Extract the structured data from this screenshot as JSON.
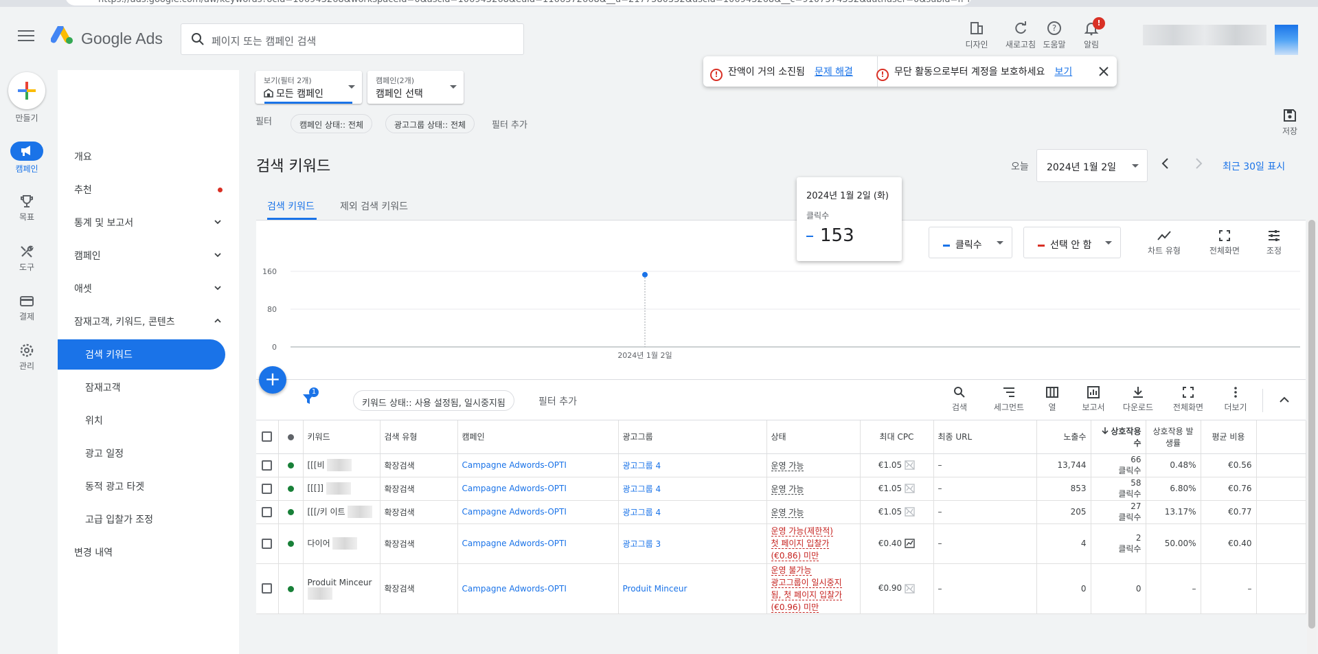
{
  "browser": {
    "url": "https://ads.google.com/aw/keywords?ocid=106943268&workspaceId=0&ascid=106943268&euid=1166372668&__u=2177580332&uscid=106943268&__c=9107574332&authuser=0&subid=fr-fr-awhp-g-aw-c-ho..."
  },
  "header": {
    "logo_text": "Google Ads",
    "search_placeholder": "페이지 또는 캠페인 검색",
    "tools": [
      {
        "label": "디자인",
        "icon": "design-icon"
      },
      {
        "label": "새로고침",
        "icon": "refresh-icon"
      },
      {
        "label": "도움말",
        "icon": "help-icon"
      },
      {
        "label": "알림",
        "icon": "bell-icon"
      }
    ],
    "notification_badge": "!"
  },
  "rail": {
    "create_label": "만들기",
    "items": [
      {
        "label": "캠페인",
        "icon": "megaphone-icon",
        "active": true
      },
      {
        "label": "목표",
        "icon": "trophy-icon"
      },
      {
        "label": "도구",
        "icon": "wrench-icon"
      },
      {
        "label": "결제",
        "icon": "credit-card-icon"
      },
      {
        "label": "관리",
        "icon": "gear-icon"
      }
    ]
  },
  "nav": {
    "items": [
      {
        "label": "개요"
      },
      {
        "label": "추천"
      },
      {
        "label": "통계 및 보고서"
      },
      {
        "label": "캠페인"
      },
      {
        "label": "애셋"
      },
      {
        "label": "잠재고객, 키워드, 콘텐츠"
      },
      {
        "label": "검색 키워드"
      },
      {
        "label": "잠재고객"
      },
      {
        "label": "위치"
      },
      {
        "label": "광고 일정"
      },
      {
        "label": "동적 광고 타겟"
      },
      {
        "label": "고급 입찰가 조정"
      },
      {
        "label": "변경 내역"
      }
    ]
  },
  "view_selector": {
    "small": "보기(필터 2개)",
    "value": "모든 캠페인"
  },
  "campaign_selector": {
    "small": "캠페인(2개)",
    "value": "캠페인 선택"
  },
  "alerts": [
    {
      "text": "잔액이 거의 소진됨",
      "link": "문제 해결"
    },
    {
      "text": "무단 활동으로부터 계정을 보호하세요",
      "link": "보기"
    }
  ],
  "filters": {
    "label": "필터",
    "chips": [
      "캠페인 상태:: 전체",
      "광고그룹 상태:: 전체"
    ],
    "add": "필터 추가"
  },
  "save_label": "저장",
  "page_title": "검색 키워드",
  "date": {
    "today_label": "오늘",
    "value": "2024년 1월 2일",
    "range_link": "최근 30일 표시"
  },
  "tabs": [
    "검색 키워드",
    "제외 검색 키워드"
  ],
  "chart_data": {
    "type": "line",
    "x": [
      "2024년 1월 2일"
    ],
    "series": [
      {
        "values": [
          153
        ]
      }
    ],
    "yticks": [
      0,
      80,
      160
    ],
    "ylim": [
      0,
      160
    ],
    "xlabel": "",
    "ylabel": "",
    "grid": true
  },
  "tooltip": {
    "date": "2024년 1월 2일 (화)",
    "metric": "클릭수",
    "value": "153"
  },
  "metric_selectors": [
    {
      "label": "클릭수",
      "color": "#1a73e8"
    },
    {
      "label": "선택 안 함",
      "color": "#d93025"
    }
  ],
  "chart_tools": [
    "차트 유형",
    "전체화면",
    "조정"
  ],
  "table_toolbar": {
    "filter_badge": "1",
    "status_chip": "키워드 상태:: 사용 설정됨, 일시중지됨",
    "add_filter": "필터 추가",
    "tools": [
      {
        "label": "검색",
        "icon": "search-icon"
      },
      {
        "label": "세그먼트",
        "icon": "segment-icon"
      },
      {
        "label": "열",
        "icon": "columns-icon"
      },
      {
        "label": "보고서",
        "icon": "report-icon"
      },
      {
        "label": "다운로드",
        "icon": "download-icon"
      },
      {
        "label": "전체화면",
        "icon": "fullscreen-icon"
      },
      {
        "label": "더보기",
        "icon": "more-vert-icon"
      }
    ]
  },
  "table": {
    "columns": [
      "키워드",
      "검색 유형",
      "캠페인",
      "광고그룹",
      "상태",
      "최대 CPC",
      "최종 URL",
      "노출수",
      "상호작용수",
      "상호작용 발생률",
      "평균 비용"
    ],
    "clicks_unit": "클릭수",
    "rows": [
      {
        "keyword": "[[[비",
        "match": "확장검색",
        "campaign": "Campagne  Adwords-OPTI",
        "adgroup": "광고그룹 4",
        "status": [
          "운영 가능"
        ],
        "warn": false,
        "cpc": "€1.05",
        "url": "–",
        "impr": "13,744",
        "inter": "66",
        "rate": "0.48%",
        "avg": "€0.56",
        "h": 34
      },
      {
        "keyword": "[[[]]",
        "match": "확장검색",
        "campaign": "Campagne  Adwords-OPTI",
        "adgroup": "광고그룹 4",
        "status": [
          "운영 가능"
        ],
        "warn": false,
        "cpc": "€1.05",
        "url": "–",
        "impr": "853",
        "inter": "58",
        "rate": "6.80%",
        "avg": "€0.76",
        "h": 34
      },
      {
        "keyword": "[[[/키 이트",
        "match": "확장검색",
        "campaign": "Campagne  Adwords-OPTI",
        "adgroup": "광고그룹 4",
        "status": [
          "운영 가능"
        ],
        "warn": false,
        "cpc": "€1.05",
        "url": "–",
        "impr": "205",
        "inter": "27",
        "rate": "13.17%",
        "avg": "€0.77",
        "h": 34
      },
      {
        "keyword": "다이어",
        "match": "확장검색",
        "campaign": "Campagne  Adwords-OPTI",
        "adgroup": "광고그룹 3",
        "status": [
          "운영 가능(제한적)",
          "첫 페이지 입찰가",
          "(€0.86) 미만"
        ],
        "warn": true,
        "cpc": "€0.40",
        "url": "–",
        "impr": "4",
        "inter": "2",
        "rate": "50.00%",
        "avg": "€0.40",
        "h": 58
      },
      {
        "keyword": "Produit Minceur",
        "match": "확장검색",
        "campaign": "Campagne  Adwords-OPTI",
        "adgroup": "Produit Minceur",
        "status": [
          "운영 불가능",
          "광고그룹이 일시중지",
          "됨, 첫 페이지 입찰가",
          "(€0.96) 미만"
        ],
        "warn": true,
        "cpc": "€0.90",
        "url": "–",
        "impr": "0",
        "inter": "0",
        "rate": "–",
        "avg": "–",
        "h": 72
      }
    ]
  }
}
